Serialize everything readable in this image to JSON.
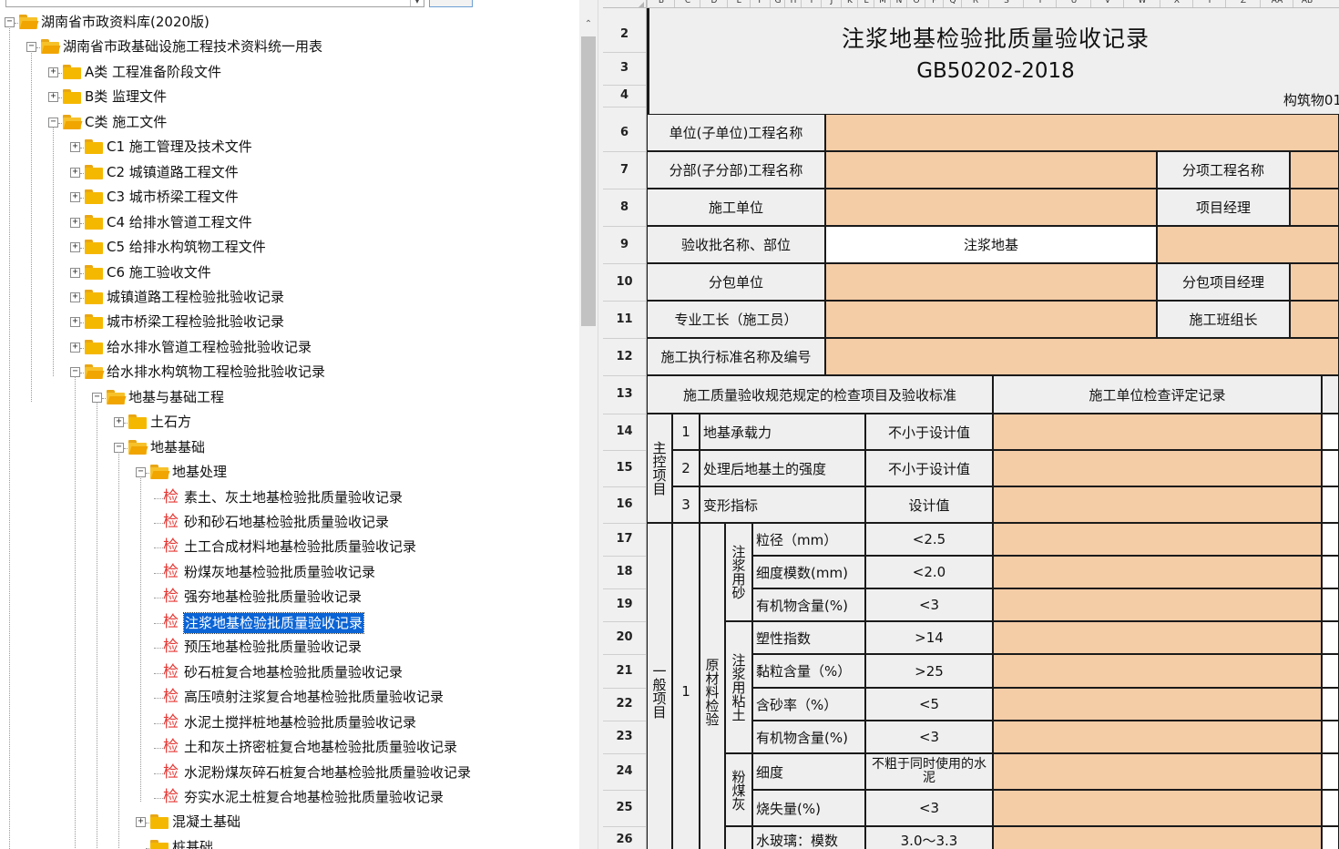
{
  "tree": {
    "items": [
      {
        "label": "湖南省市政资料库(2020版)",
        "expander": "−"
      },
      {
        "label": "湖南省市政基础设施工程技术资料统一用表",
        "expander": "−"
      },
      {
        "label": "A类 工程准备阶段文件",
        "expander": "+"
      },
      {
        "label": "B类 监理文件",
        "expander": "+"
      },
      {
        "label": "C类 施工文件",
        "expander": "−"
      },
      {
        "label": "C1 施工管理及技术文件",
        "expander": "+"
      },
      {
        "label": "C2 城镇道路工程文件",
        "expander": "+"
      },
      {
        "label": "C3 城市桥梁工程文件",
        "expander": "+"
      },
      {
        "label": "C4 给排水管道工程文件",
        "expander": "+"
      },
      {
        "label": "C5 给排水构筑物工程文件",
        "expander": "+"
      },
      {
        "label": "C6 施工验收文件",
        "expander": "+"
      },
      {
        "label": "城镇道路工程检验批验收记录",
        "expander": "+"
      },
      {
        "label": "城市桥梁工程检验批验收记录",
        "expander": "+"
      },
      {
        "label": "给水排水管道工程检验批验收记录",
        "expander": "+"
      },
      {
        "label": "给水排水构筑物工程检验批验收记录",
        "expander": "−"
      },
      {
        "label": "地基与基础工程",
        "expander": "−"
      },
      {
        "label": "土石方",
        "expander": "+"
      },
      {
        "label": "地基基础",
        "expander": "−"
      },
      {
        "label": "地基处理",
        "expander": "−"
      },
      {
        "label": "素土、灰土地基检验批质量验收记录",
        "mark": "检"
      },
      {
        "label": "砂和砂石地基检验批质量验收记录",
        "mark": "检"
      },
      {
        "label": "土工合成材料地基检验批质量验收记录",
        "mark": "检"
      },
      {
        "label": "粉煤灰地基检验批质量验收记录",
        "mark": "检"
      },
      {
        "label": "强夯地基检验批质量验收记录",
        "mark": "检"
      },
      {
        "label": "注浆地基检验批质量验收记录",
        "mark": "检"
      },
      {
        "label": "预压地基检验批质量验收记录",
        "mark": "检"
      },
      {
        "label": "砂石桩复合地基检验批质量验收记录",
        "mark": "检"
      },
      {
        "label": "高压喷射注浆复合地基检验批质量验收记录",
        "mark": "检"
      },
      {
        "label": "水泥土搅拌桩地基检验批质量验收记录",
        "mark": "检"
      },
      {
        "label": "土和灰土挤密桩复合地基检验批质量验收记录",
        "mark": "检"
      },
      {
        "label": "水泥粉煤灰碎石桩复合地基检验批质量验收记录",
        "mark": "检"
      },
      {
        "label": "夯实水泥土桩复合地基检验批质量验收记录",
        "mark": "检"
      },
      {
        "label": "混凝土基础",
        "expander": "+"
      },
      {
        "label": "桩基础",
        "expander": ""
      }
    ],
    "selected_index": 24
  },
  "scroll": {
    "up_arrow": "⌃"
  },
  "sheet": {
    "columns": [
      "B",
      "C",
      "D",
      "E",
      "F",
      "G",
      "H",
      "I",
      "J",
      "K",
      "L",
      "M",
      "N",
      "O",
      "P",
      "Q",
      "R",
      "S",
      "T",
      "U",
      "V",
      "W",
      "X",
      "Y",
      "Z",
      "AA",
      "AB"
    ],
    "rows": [
      "2",
      "3",
      "4",
      "6",
      "7",
      "8",
      "9",
      "10",
      "11",
      "12",
      "13",
      "14",
      "15",
      "16",
      "17",
      "18",
      "19",
      "20",
      "21",
      "22",
      "23",
      "24",
      "25",
      "26"
    ],
    "title": "注浆地基检验批质量验收记录",
    "standard": "GB50202-2018",
    "code": "构筑物01",
    "labels": {
      "unit_name": "单位(子单位)工程名称",
      "part_name": "分部(子分部)工程名称",
      "item_name": "分项工程名称",
      "contractor": "施工单位",
      "pm": "项目经理",
      "batch": "验收批名称、部位",
      "batch_value": "注浆地基",
      "sub_contractor": "分包单位",
      "sub_pm": "分包项目经理",
      "foreman": "专业工长（施工员）",
      "team_leader": "施工班组长",
      "std_name": "施工执行标准名称及编号",
      "check_items": "施工质量验收规范规定的检查项目及验收标准",
      "contractor_record": "施工单位检查评定记录",
      "main_items": "主控项目",
      "general_items": "一般项目",
      "raw_material": "原材料检验",
      "grout_sand": "注浆用砂",
      "grout_clay": "注浆用粘土",
      "fly_ash": "粉煤灰"
    },
    "main_control": [
      {
        "no": "1",
        "item": "地基承载力",
        "standard": "不小于设计值"
      },
      {
        "no": "2",
        "item": "处理后地基土的强度",
        "standard": "不小于设计值"
      },
      {
        "no": "3",
        "item": "变形指标",
        "standard": "设计值"
      }
    ],
    "general": {
      "no": "1",
      "rows": [
        {
          "item": "粒径（mm）",
          "standard": "<2.5"
        },
        {
          "item": "细度模数(mm)",
          "standard": "<2.0"
        },
        {
          "item": "有机物含量(%)",
          "standard": "<3"
        },
        {
          "item": "塑性指数",
          "standard": ">14"
        },
        {
          "item": "黏粒含量（%）",
          "standard": ">25"
        },
        {
          "item": "含砂率（%）",
          "standard": "<5"
        },
        {
          "item": "有机物含量(%)",
          "standard": "<3"
        },
        {
          "item": "细度",
          "standard": "不粗于同时使用的水泥"
        },
        {
          "item": "烧失量(%)",
          "standard": "<3"
        },
        {
          "item": "水玻璃：模数",
          "standard": "3.0～3.3"
        }
      ]
    }
  }
}
